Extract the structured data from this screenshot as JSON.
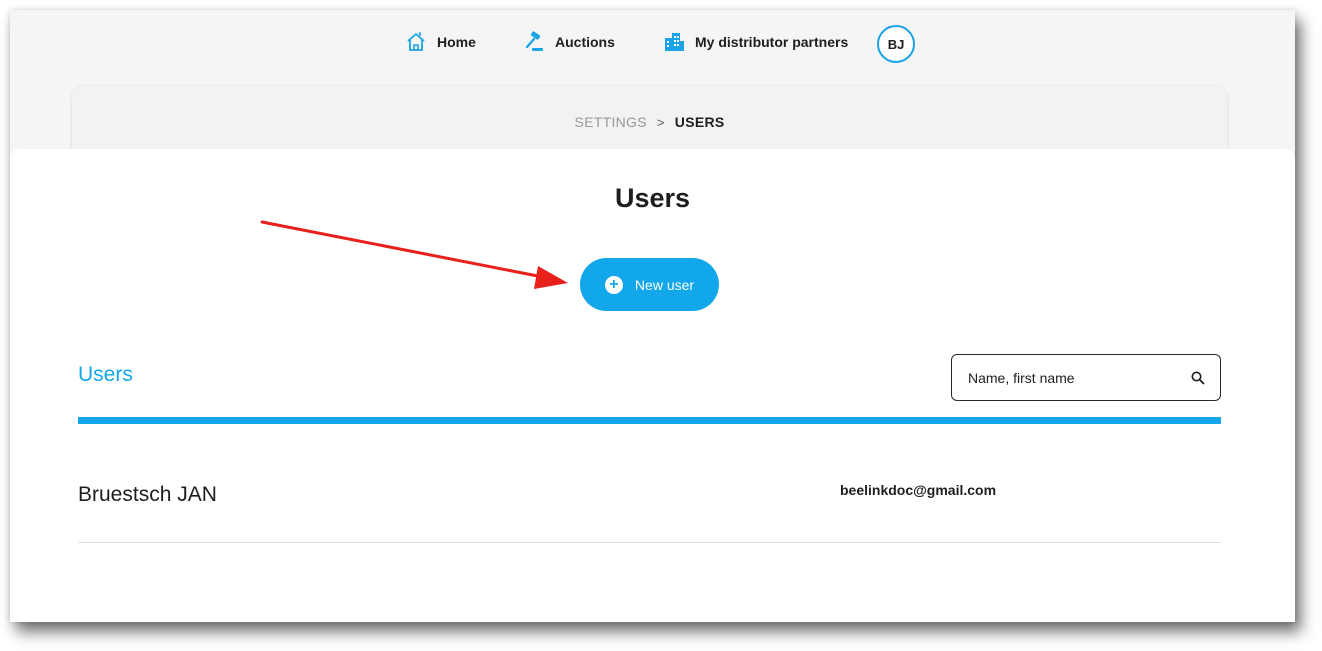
{
  "nav": {
    "home_label": "Home",
    "auctions_label": "Auctions",
    "partners_label": "My distributor partners",
    "avatar_initials": "BJ",
    "icon_color": "#1aa3e6"
  },
  "breadcrumb": {
    "parent": "SETTINGS",
    "separator": ">",
    "current": "USERS"
  },
  "page": {
    "title": "Users"
  },
  "actions": {
    "new_user_label": "New user",
    "accent_color": "#12a7ea"
  },
  "users_section": {
    "title": "Users",
    "search_placeholder": "Name, first name",
    "rows": [
      {
        "name": "Bruestsch JAN",
        "email": "beelinkdoc@gmail.com"
      }
    ]
  },
  "annotation": {
    "arrow_color": "#e8201c",
    "points_to": "new-user-button"
  }
}
